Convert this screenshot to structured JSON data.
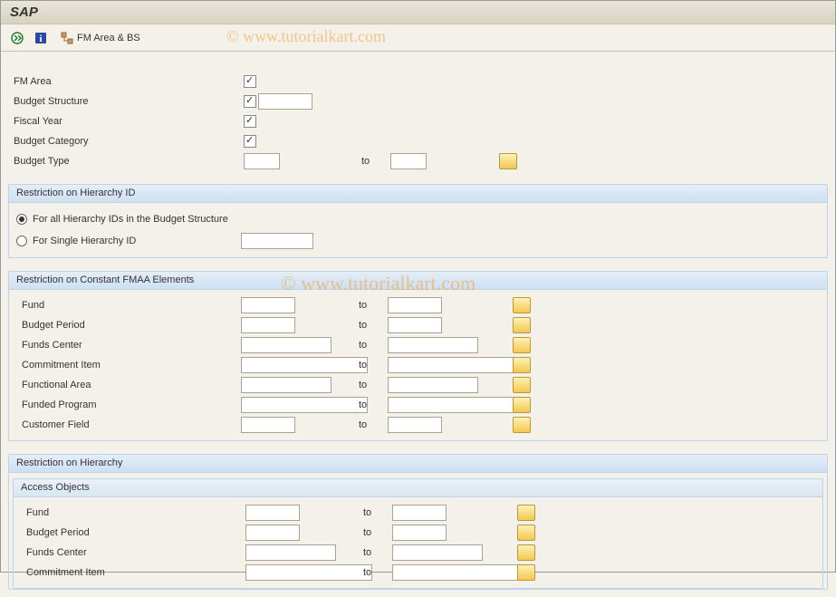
{
  "title": "SAP",
  "watermark": "© www.tutorialkart.com",
  "toolbar": {
    "fm_area_bs_label": "FM Area & BS"
  },
  "top_fields": {
    "fm_area": "FM Area",
    "budget_structure": "Budget Structure",
    "fiscal_year": "Fiscal Year",
    "budget_category": "Budget Category",
    "budget_type": "Budget Type",
    "to": "to"
  },
  "group_hierarchy_id": {
    "title": "Restriction on Hierarchy ID",
    "radio_all": "For all Hierarchy IDs in the Budget Structure",
    "radio_single": "For Single Hierarchy ID"
  },
  "group_constant_fmaa": {
    "title": "Restriction on Constant FMAA Elements",
    "to": "to",
    "rows": {
      "fund": "Fund",
      "budget_period": "Budget Period",
      "funds_center": "Funds Center",
      "commitment_item": "Commitment Item",
      "functional_area": "Functional Area",
      "funded_program": "Funded Program",
      "customer_field": "Customer Field"
    }
  },
  "group_restriction_hierarchy": {
    "title": "Restriction on Hierarchy",
    "access_objects": "Access Objects",
    "to": "to",
    "rows": {
      "fund": "Fund",
      "budget_period": "Budget Period",
      "funds_center": "Funds Center",
      "commitment_item": "Commitment Item"
    }
  }
}
